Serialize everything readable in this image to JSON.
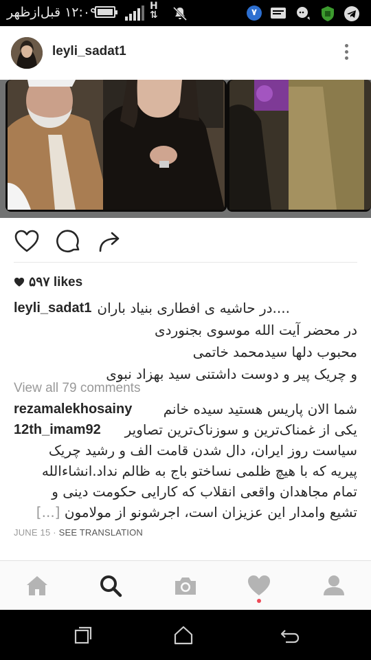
{
  "status_bar": {
    "time": "۱۲:۰۹ قبل‌ازظهر",
    "network": "H",
    "badge_number": "۷"
  },
  "post": {
    "username": "leyli_sadat1",
    "likes_count": "۵۹۷ likes",
    "caption": {
      "author": "leyli_sadat1",
      "lines": [
        "....در حاشیه ی افطاری بنیاد باران",
        "در محضر آیت الله موسوی بجنوردی",
        "محبوب دلها سیدمحمد خاتمی",
        "و چریک پیر و دوست داشتنی سید بهزاد نبوی"
      ]
    },
    "view_all_comments": "View all 79 comments",
    "comments": [
      {
        "author": "rezamalekhosainy",
        "text": "شما الان پاریس هستید سیده خانم"
      },
      {
        "author": "12th_imam92",
        "text": "یکی از غمناک‌ترین و سوزناک‌ترین تصاویر",
        "continuation": [
          "سیاست روز ایران، دال شدن قامت الف و رشید چریک",
          "پیریه که با هیچ ظلمی نساختو باج به ظالم نداد.انشاءالله",
          "تمام مجاهدان واقعی انقلاب که کارایی حکومت دینی و",
          "تشیع  وامدار این عزیزان است، اجرشونو از مولامون"
        ],
        "more": "[...]"
      }
    ],
    "date": "JUNE 15",
    "separator": " · ",
    "see_translation": "SEE TRANSLATION"
  },
  "icons": {
    "like": "heart-outline",
    "comment": "speech-bubble",
    "share": "share-arrow",
    "home": "home",
    "search": "search",
    "camera": "camera",
    "activity": "heart",
    "profile": "person"
  },
  "colors": {
    "status_bar_bg": "#000000",
    "text": "#262626",
    "muted": "#999999",
    "notification_dot": "#ed4956",
    "badge_blue": "#2d6fd0"
  }
}
